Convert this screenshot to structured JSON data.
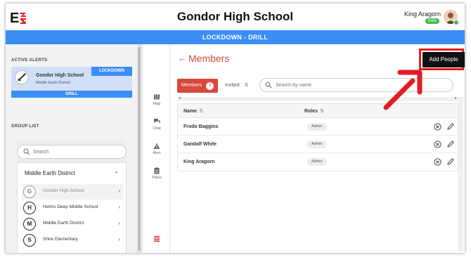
{
  "header": {
    "logo_text": "E3",
    "title": "Gondor High School",
    "user_name": "King Aragorn",
    "user_status": "Safe"
  },
  "banner": {
    "text": "LOCKDOWN - DRILL"
  },
  "sidebar": {
    "active_alerts_label": "ACTIVE ALERTS",
    "alert": {
      "school": "Gondor High School",
      "district": "Middle Earth District",
      "type": "LOCKDOWN",
      "mode": "DRILL"
    },
    "group_list_label": "GROUP LIST",
    "search_placeholder": "Search",
    "district_name": "Middle Earth District",
    "groups": [
      {
        "initial": "G",
        "name": "Gondor High School",
        "selected": true
      },
      {
        "initial": "H",
        "name": "Helms Deep Middle School",
        "selected": false
      },
      {
        "initial": "M",
        "name": "Middle Earth District",
        "selected": false
      },
      {
        "initial": "S",
        "name": "Shire Elementary",
        "selected": false
      }
    ]
  },
  "nav": {
    "items": [
      {
        "icon": "map-icon",
        "label": "Map"
      },
      {
        "icon": "chat-icon",
        "label": "Chat"
      },
      {
        "icon": "alert-icon",
        "label": "Alert"
      },
      {
        "icon": "plans-icon",
        "label": "Plans"
      }
    ],
    "bottom_icon": "list-icon"
  },
  "main": {
    "title": "Members",
    "add_button": "Add People",
    "tabs": {
      "members_label": "Members",
      "members_count": "3",
      "invited_label": "Invited",
      "invited_count": "0"
    },
    "search_placeholder": "Search by name",
    "columns": {
      "name": "Name",
      "roles": "Roles"
    },
    "rows": [
      {
        "name": "Frodo Baggins",
        "role": "Admin"
      },
      {
        "name": "Gandalf White",
        "role": "Admin"
      },
      {
        "name": "King Aragorn",
        "role": "Admin"
      }
    ]
  },
  "colors": {
    "accent_blue": "#3a8ef6",
    "accent_red": "#d9483b",
    "safe_green": "#45b649",
    "annotation_red": "#e31c24"
  }
}
